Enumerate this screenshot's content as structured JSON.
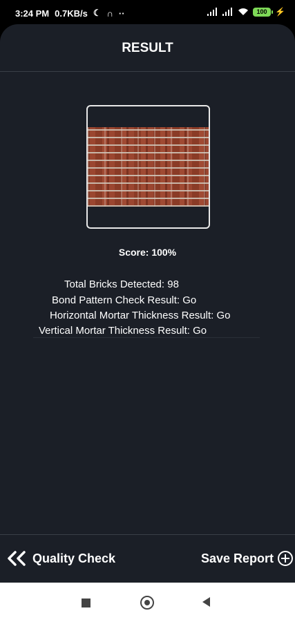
{
  "status_bar": {
    "time": "3:24 PM",
    "speed": "0.7KB/s",
    "battery": "100"
  },
  "header": {
    "title": "RESULT"
  },
  "result": {
    "score_label": "Score:  100%",
    "lines": [
      "Total Bricks Detected: 98",
      "Bond Pattern Check Result: Go",
      "Horizontal Mortar Thickness Result: Go",
      "Vertical Mortar Thickness Result: Go"
    ]
  },
  "bottom_bar": {
    "back_label": "Quality Check",
    "save_label": "Save Report"
  },
  "icons": {
    "back": "double-chevron-left-icon",
    "save": "plus-circle-icon"
  },
  "colors": {
    "background": "#1b1f27",
    "divider": "#3a3f47",
    "text": "#ffffff",
    "brick": "#8a3b26"
  }
}
